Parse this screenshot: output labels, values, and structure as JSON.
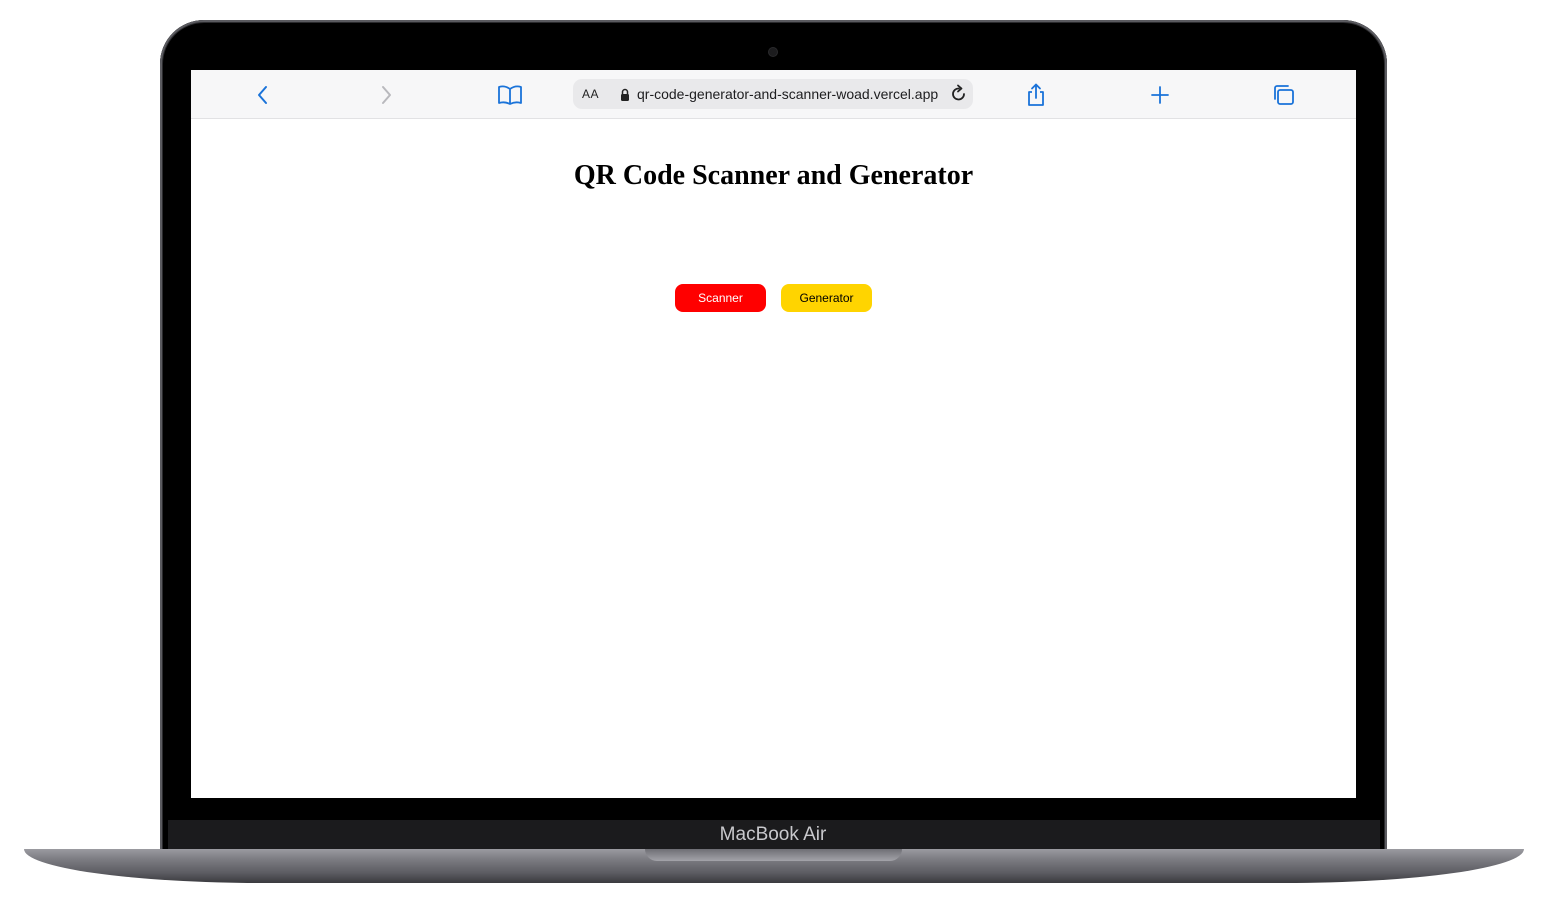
{
  "device": {
    "brand_label": "MacBook Air"
  },
  "browser": {
    "text_size_label": "AA",
    "url": "qr-code-generator-and-scanner-woad.vercel.app",
    "icons": {
      "back": "chevron-left-icon",
      "forward": "chevron-right-icon",
      "bookmarks": "book-icon",
      "lock": "lock-icon",
      "reload": "reload-icon",
      "share": "share-icon",
      "new_tab": "plus-icon",
      "tabs": "tabs-overview-icon"
    },
    "accent_color": "#1a73d9"
  },
  "page": {
    "title": "QR Code Scanner and Generator",
    "buttons": {
      "scanner_label": "Scanner",
      "generator_label": "Generator"
    },
    "colors": {
      "scanner": "#ff0000",
      "generator": "#ffd400"
    }
  }
}
